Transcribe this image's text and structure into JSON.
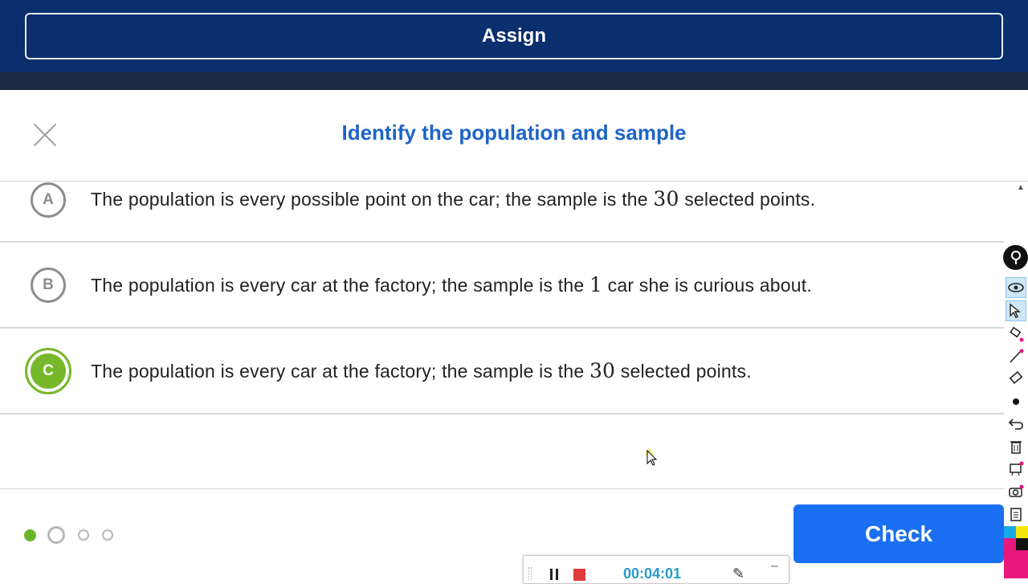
{
  "topbar": {
    "assign_label": "Assign"
  },
  "modal": {
    "title": "Identify the population and sample",
    "options": [
      {
        "letter": "A",
        "text_before": "The population is every possible point on the car; the sample is the",
        "number": "30",
        "text_after": "selected points.",
        "selected": false
      },
      {
        "letter": "B",
        "text_before": "The population is every car at the factory; the sample is the",
        "number": "1",
        "text_after": "car she is curious about.",
        "selected": false
      },
      {
        "letter": "C",
        "text_before": "The population is every car at the factory; the sample is the",
        "number": "30",
        "text_after": "selected points.",
        "selected": true
      }
    ]
  },
  "footer": {
    "progress": {
      "total": 4,
      "current": 1
    },
    "check_label": "Check"
  },
  "recorder": {
    "time": "00:04:01"
  },
  "colors": {
    "topbar": "#0a2e6e",
    "title": "#1e64c8",
    "selected_green": "#76b82a",
    "check_blue": "#1a6ef2"
  },
  "icons": {
    "close": "close-icon",
    "toolbar": [
      "pin-icon",
      "eye-icon",
      "pointer-icon",
      "highlighter-icon",
      "pen-icon",
      "eraser-icon",
      "dot-icon",
      "undo-icon",
      "trash-icon",
      "whiteboard-icon",
      "camera-icon",
      "notes-icon"
    ]
  }
}
